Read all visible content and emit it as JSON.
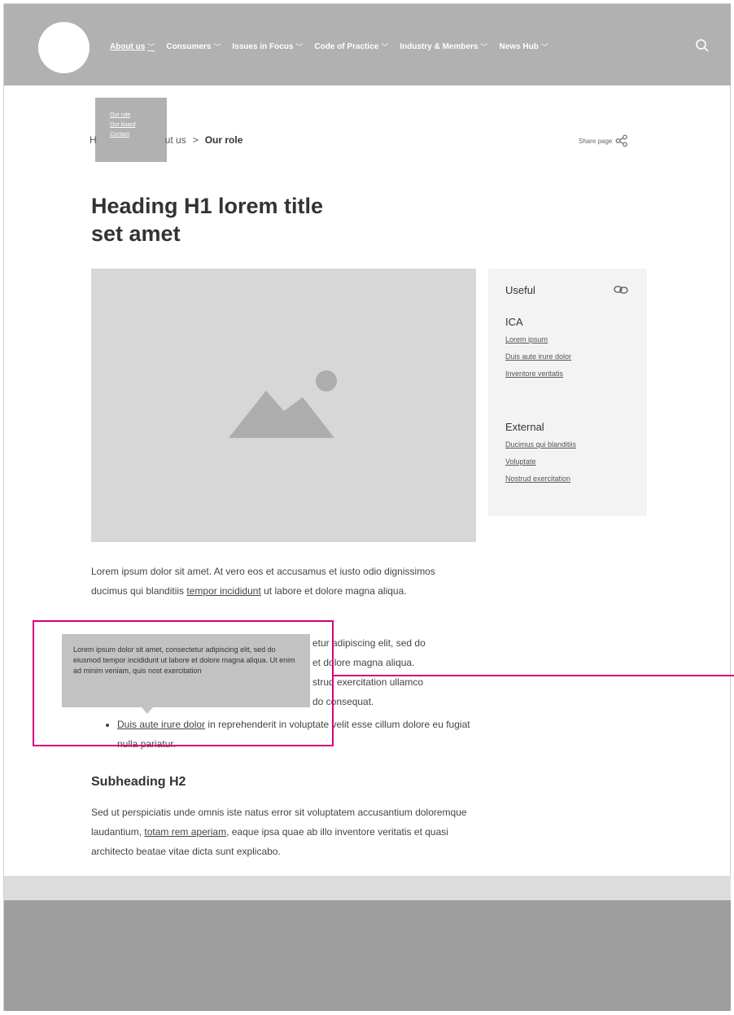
{
  "nav": {
    "items": [
      {
        "label": "About us"
      },
      {
        "label": "Consumers"
      },
      {
        "label": "Issues in Focus"
      },
      {
        "label": "Code of Practice"
      },
      {
        "label": "Industry & Members"
      },
      {
        "label": "News Hub"
      }
    ],
    "dropdown": [
      "Our role",
      "Our board",
      "Contact"
    ]
  },
  "breadcrumb": {
    "partial_home": "H",
    "partial_parent": "ut us",
    "separator": ">",
    "current": "Our role"
  },
  "share_label": "Share page",
  "page_title": "Heading H1 lorem title set amet",
  "sidebar": {
    "title": "Useful",
    "groups": [
      {
        "heading": "ICA",
        "links": [
          "Lorem ipsum",
          "Duis aute irure dolor",
          "Inventore veritatis"
        ]
      },
      {
        "heading": "External",
        "links": [
          "Ducimus qui blanditiis",
          "Voluptate",
          "Nostrud exercitation"
        ]
      }
    ]
  },
  "content": {
    "para1_a": "Lorem ipsum dolor sit amet.  At vero eos et accusamus et iusto odio dignissimos ducimus qui blanditiis ",
    "para1_link": "tempor incididunt",
    "para1_b": " ut labore et dolore magna aliqua.",
    "bullets_visible": [
      "etur adipiscing elit, sed do",
      "et dolore magna aliqua.",
      "strud exercitation ullamco",
      "do consequat."
    ],
    "bullet_last_link": "Duis aute irure dolor",
    "bullet_last_rest": " in reprehenderit in voluptate velit esse cillum dolore eu fugiat nulla pariatur.",
    "subheading": "Subheading H2",
    "para2_a": "Sed ut perspiciatis unde omnis iste natus error sit voluptatem accusantium doloremque laudantium, ",
    "para2_link": "totam rem aperiam",
    "para2_b": ", eaque ipsa quae ab illo inventore veritatis et quasi architecto beatae vitae dicta sunt explicabo."
  },
  "tooltip": "Lorem ipsum dolor sit amet, consectetur adipiscing elit, sed do eiusmod tempor incididunt ut labore et dolore magna aliqua. Ut enim ad minim veniam, quis nost exercitation",
  "colors": {
    "nav_bg": "#b1b1b1",
    "annotation": "#d6007e",
    "image_placeholder": "#d7d7d7",
    "sidebar_bg": "#f3f3f3"
  }
}
